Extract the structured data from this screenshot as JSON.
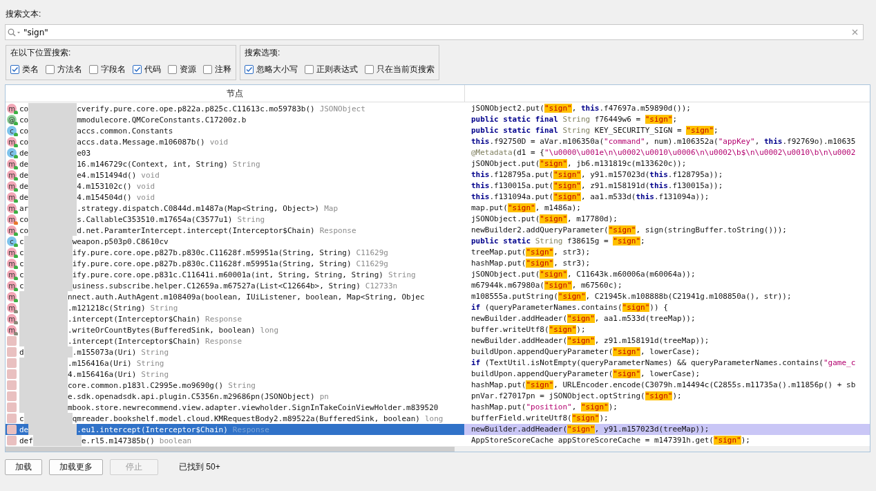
{
  "search": {
    "label": "搜索文本:",
    "value": "\"sign\""
  },
  "groups": [
    {
      "title": "在以下位置搜索:",
      "options": [
        {
          "label": "类名",
          "checked": true
        },
        {
          "label": "方法名",
          "checked": false
        },
        {
          "label": "字段名",
          "checked": false
        },
        {
          "label": "代码",
          "checked": true
        },
        {
          "label": "资源",
          "checked": false
        },
        {
          "label": "注释",
          "checked": false
        }
      ]
    },
    {
      "title": "搜索选项:",
      "options": [
        {
          "label": "忽略大小写",
          "checked": true
        },
        {
          "label": "正则表达式",
          "checked": false
        },
        {
          "label": "只在当前页搜索",
          "checked": false
        }
      ]
    }
  ],
  "table": {
    "columns": [
      "节点"
    ],
    "rows": [
      {
        "icon": "m",
        "color": "#3cb043",
        "prefix": "co",
        "name": "cverify.pure.core.ope.p822a.p825c.C11613c.mo59783b()",
        "type": "JSONObject",
        "selected": false,
        "code": [
          {
            "kind": "p",
            "text": "jSONObject2.put("
          },
          {
            "kind": "m",
            "text": "\"sign\""
          },
          {
            "kind": "p",
            "text": ", "
          },
          {
            "kind": "k",
            "text": "this"
          },
          {
            "kind": "p",
            "text": ".f47697a.m59890d());"
          }
        ]
      },
      {
        "icon": "@",
        "color": "#3cb043",
        "prefix": "co",
        "name": "mmodulecore.QMCoreConstants.C17200z.b",
        "selected": false,
        "code": [
          {
            "kind": "k",
            "text": "public static final "
          },
          {
            "kind": "t",
            "text": "String"
          },
          {
            "kind": "p",
            "text": " f76449w6 = "
          },
          {
            "kind": "m",
            "text": "\"sign\""
          },
          {
            "kind": "p",
            "text": ";"
          }
        ]
      },
      {
        "icon": "c",
        "color": "#3cb043",
        "prefix": "co",
        "name": "accs.common.Constants",
        "selected": false,
        "code": [
          {
            "kind": "k",
            "text": "public static final "
          },
          {
            "kind": "t",
            "text": "String"
          },
          {
            "kind": "p",
            "text": " KEY_SECURITY_SIGN = "
          },
          {
            "kind": "m",
            "text": "\"sign\""
          },
          {
            "kind": "p",
            "text": ";"
          }
        ]
      },
      {
        "icon": "m",
        "color": "#3cb043",
        "prefix": "co",
        "name": "accs.data.Message.m106087b()",
        "type": "void",
        "selected": false,
        "code": [
          {
            "kind": "k",
            "text": "this"
          },
          {
            "kind": "p",
            "text": ".f92750D = aVar.m106350a("
          },
          {
            "kind": "s",
            "text": "\"command\""
          },
          {
            "kind": "p",
            "text": ", num).m106352a("
          },
          {
            "kind": "s",
            "text": "\"appKey\""
          },
          {
            "kind": "p",
            "text": ", "
          },
          {
            "kind": "k",
            "text": "this"
          },
          {
            "kind": "p",
            "text": ".f92769o).m10635"
          }
        ]
      },
      {
        "icon": "c",
        "color": "#3cb043",
        "prefix": "de",
        "name": "e03",
        "selected": false,
        "code": [
          {
            "kind": "t",
            "text": "@Metadata"
          },
          {
            "kind": "p",
            "text": "(d1 = {"
          },
          {
            "kind": "s",
            "text": "\"\\u0000\\u001e\\n\\u0002\\u0010\\u0006\\n\\u0002\\b$\\n\\u0002\\u0010\\b\\n\\u0002"
          }
        ]
      },
      {
        "icon": "m",
        "color": "#3cb043",
        "prefix": "de",
        "name": "16.m146729c(Context, int, String)",
        "type": "String",
        "selected": false,
        "code": [
          {
            "kind": "p",
            "text": "jSONObject.put("
          },
          {
            "kind": "m",
            "text": "\"sign\""
          },
          {
            "kind": "p",
            "text": ", jb6.m131819c(m133620c));"
          }
        ]
      },
      {
        "icon": "m",
        "color": "#3cb043",
        "prefix": "de",
        "name": "e4.m151494d()",
        "type": "void",
        "selected": false,
        "code": [
          {
            "kind": "k",
            "text": "this"
          },
          {
            "kind": "p",
            "text": ".f128795a.put("
          },
          {
            "kind": "m",
            "text": "\"sign\""
          },
          {
            "kind": "p",
            "text": ", y91.m157023d("
          },
          {
            "kind": "k",
            "text": "this"
          },
          {
            "kind": "p",
            "text": ".f128795a));"
          }
        ]
      },
      {
        "icon": "m",
        "color": "#3cb043",
        "prefix": "de",
        "name": "4.m153102c()",
        "type": "void",
        "selected": false,
        "code": [
          {
            "kind": "k",
            "text": "this"
          },
          {
            "kind": "p",
            "text": ".f130015a.put("
          },
          {
            "kind": "m",
            "text": "\"sign\""
          },
          {
            "kind": "p",
            "text": ", z91.m158191d("
          },
          {
            "kind": "k",
            "text": "this"
          },
          {
            "kind": "p",
            "text": ".f130015a));"
          }
        ]
      },
      {
        "icon": "m",
        "color": "#3cb043",
        "prefix": "de",
        "name": "4.m154504d()",
        "type": "void",
        "selected": false,
        "code": [
          {
            "kind": "k",
            "text": "this"
          },
          {
            "kind": "p",
            "text": ".f131094a.put("
          },
          {
            "kind": "m",
            "text": "\"sign\""
          },
          {
            "kind": "p",
            "text": ", aa1.m533d("
          },
          {
            "kind": "k",
            "text": "this"
          },
          {
            "kind": "p",
            "text": ".f131094a));"
          }
        ]
      },
      {
        "icon": "m",
        "color": "#3cb043",
        "prefix": "ar",
        "name": ".strategy.dispatch.C0844d.m1487a(Map<String, Object>)",
        "type": "Map",
        "selected": false,
        "code": [
          {
            "kind": "p",
            "text": "map.put("
          },
          {
            "kind": "m",
            "text": "\"sign\""
          },
          {
            "kind": "p",
            "text": ", m1486a);"
          }
        ]
      },
      {
        "icon": "m",
        "color": "#e8762c",
        "prefix": "co",
        "name": "s.CallableC353510.m17654a(C3577u1)",
        "type": "String",
        "selected": false,
        "code": [
          {
            "kind": "p",
            "text": "jSONObject.put("
          },
          {
            "kind": "m",
            "text": "\"sign\""
          },
          {
            "kind": "p",
            "text": ", m17780d);"
          }
        ]
      },
      {
        "icon": "m",
        "color": "#3cb043",
        "prefix": "co",
        "name": "d.net.ParamterIntercept.intercept(Interceptor$Chain)",
        "type": "Response",
        "selected": false,
        "code": [
          {
            "kind": "p",
            "text": "newBuilder2.addQueryParameter("
          },
          {
            "kind": "m",
            "text": "\"sign\""
          },
          {
            "kind": "p",
            "text": ", sign(stringBuffer.toString()));"
          }
        ]
      },
      {
        "icon": "c",
        "color": "#3cb043",
        "prefix": "c",
        "name": "weapon.p503p0.C8610cv",
        "selected": false,
        "code": [
          {
            "kind": "k",
            "text": "public static "
          },
          {
            "kind": "t",
            "text": "String"
          },
          {
            "kind": "p",
            "text": " f38615g = "
          },
          {
            "kind": "m",
            "text": "\"sign\""
          },
          {
            "kind": "p",
            "text": ";"
          }
        ]
      },
      {
        "icon": "m",
        "color": "#3cb043",
        "prefix": "c",
        "name": "ify.pure.core.ope.p827b.p830c.C11628f.m59951a(String, String)",
        "type": "C11629g",
        "selected": false,
        "code": [
          {
            "kind": "p",
            "text": "treeMap.put("
          },
          {
            "kind": "m",
            "text": "\"sign\""
          },
          {
            "kind": "p",
            "text": ", str3);"
          }
        ]
      },
      {
        "icon": "m",
        "color": "#3cb043",
        "prefix": "c",
        "name": "ify.pure.core.ope.p827b.p830c.C11628f.m59951a(String, String)",
        "type": "C11629g",
        "selected": false,
        "code": [
          {
            "kind": "p",
            "text": "hashMap.put("
          },
          {
            "kind": "m",
            "text": "\"sign\""
          },
          {
            "kind": "p",
            "text": ", str3);"
          }
        ]
      },
      {
        "icon": "m",
        "color": "#3cb043",
        "prefix": "c",
        "name": "ify.pure.core.ope.p831c.C11641i.m60001a(int, String, String, String)",
        "type": "String",
        "selected": false,
        "code": [
          {
            "kind": "p",
            "text": "jSONObject.put("
          },
          {
            "kind": "m",
            "text": "\"sign\""
          },
          {
            "kind": "p",
            "text": ", C11643k.m60006a(m60064a));"
          }
        ]
      },
      {
        "icon": "m",
        "color": "#3cb043",
        "prefix": "c",
        "name": "usiness.subscribe.helper.C12659a.m67527a(List<C12664b>, String)",
        "type": "C12733n",
        "selected": false,
        "code": [
          {
            "kind": "p",
            "text": "m67944k.m67980a("
          },
          {
            "kind": "m",
            "text": "\"sign\""
          },
          {
            "kind": "p",
            "text": ", m67560c);"
          }
        ]
      },
      {
        "icon": "m",
        "color": "#3cb043",
        "name": "nnect.auth.AuthAgent.m108409a(boolean, IUiListener, boolean, Map<String, Objec",
        "selected": false,
        "code": [
          {
            "kind": "p",
            "text": "m108555a.putString("
          },
          {
            "kind": "m",
            "text": "\"sign\""
          },
          {
            "kind": "p",
            "text": ", C21945k.m108888b(C21941g.m108850a(), str));"
          }
        ]
      },
      {
        "icon": "m",
        "color": "#8a8a7a",
        "name": ".m121218c(String)",
        "type": "String",
        "selected": false,
        "code": [
          {
            "kind": "k",
            "text": "if"
          },
          {
            "kind": "p",
            "text": " (queryParameterNames.contains("
          },
          {
            "kind": "m",
            "text": "\"sign\""
          },
          {
            "kind": "p",
            "text": ")) {"
          }
        ]
      },
      {
        "icon": "m",
        "color": "#8a8a7a",
        "name": ".intercept(Interceptor$Chain)",
        "type": "Response",
        "selected": false,
        "code": [
          {
            "kind": "p",
            "text": "newBuilder.addHeader("
          },
          {
            "kind": "m",
            "text": "\"sign\""
          },
          {
            "kind": "p",
            "text": ", aa1.m533d(treeMap));"
          }
        ]
      },
      {
        "icon": "m",
        "color": "#8a8a7a",
        "name": ".writeOrCountBytes(BufferedSink, boolean)",
        "type": "long",
        "selected": false,
        "code": [
          {
            "kind": "p",
            "text": "buffer.writeUtf8("
          },
          {
            "kind": "m",
            "text": "\"sign\""
          },
          {
            "kind": "p",
            "text": ");"
          }
        ]
      },
      {
        "name": ".intercept(Interceptor$Chain)",
        "type": "Response",
        "selected": false,
        "code": [
          {
            "kind": "p",
            "text": "newBuilder.addHeader("
          },
          {
            "kind": "m",
            "text": "\"sign\""
          },
          {
            "kind": "p",
            "text": ", z91.m158191d(treeMap));"
          }
        ]
      },
      {
        "prefix": "d",
        "name": ".m155073a(Uri)",
        "type": "String",
        "selected": false,
        "code": [
          {
            "kind": "p",
            "text": "buildUpon.appendQueryParameter("
          },
          {
            "kind": "m",
            "text": "\"sign\""
          },
          {
            "kind": "p",
            "text": ", lowerCase);"
          }
        ]
      },
      {
        "name": ".m156416a(Uri)",
        "type": "String",
        "selected": false,
        "code": [
          {
            "kind": "k",
            "text": "if"
          },
          {
            "kind": "p",
            "text": " (TextUtil.isNotEmpty(queryParameterNames) && queryParameterNames.contains("
          },
          {
            "kind": "s",
            "text": "\"game_c"
          }
        ]
      },
      {
        "name": "4.m156416a(Uri)",
        "type": "String",
        "selected": false,
        "code": [
          {
            "kind": "p",
            "text": "buildUpon.appendQueryParameter("
          },
          {
            "kind": "m",
            "text": "\"sign\""
          },
          {
            "kind": "p",
            "text": ", lowerCase);"
          }
        ]
      },
      {
        "name": "core.common.p183l.C2995e.mo9690g()",
        "type": "String",
        "selected": false,
        "code": [
          {
            "kind": "p",
            "text": "hashMap.put("
          },
          {
            "kind": "m",
            "text": "\"sign\""
          },
          {
            "kind": "p",
            "text": ", URLEncoder.encode(C3079h.m14494c(C2855s.m11735a().m11856p() + sb"
          }
        ]
      },
      {
        "name": "e.sdk.openadsdk.api.plugin.C5356n.m29686pn(JSONObject)",
        "type": "pn",
        "selected": false,
        "code": [
          {
            "kind": "p",
            "text": "pnVar.f27017pn = jSONObject.optString("
          },
          {
            "kind": "m",
            "text": "\"sign\""
          },
          {
            "kind": "p",
            "text": ");"
          }
        ]
      },
      {
        "name": "mbook.store.newrecommend.view.adapter.viewholder.SignInTakeCoinViewHolder.m839520",
        "selected": false,
        "code": [
          {
            "kind": "p",
            "text": "hashMap.put("
          },
          {
            "kind": "s",
            "text": "\"position\""
          },
          {
            "kind": "p",
            "text": ", "
          },
          {
            "kind": "m",
            "text": "\"sign\""
          },
          {
            "kind": "p",
            "text": ");"
          }
        ]
      },
      {
        "prefix": "c",
        "name": "qmreader.bookshelf.model.cloud.KMRequestBody2.m89522a(BufferedSink, boolean)",
        "type": "long",
        "selected": false,
        "code": [
          {
            "kind": "p",
            "text": "bufferField.writeUtf8("
          },
          {
            "kind": "m",
            "text": "\"sign\""
          },
          {
            "kind": "p",
            "text": ");"
          }
        ]
      },
      {
        "prefix": "de",
        "name": ".eu1.intercept(Interceptor$Chain)",
        "type": "Response",
        "selected": true,
        "code": [
          {
            "kind": "p",
            "text": "newBuilder.addHeader("
          },
          {
            "kind": "m",
            "text": "\"sign\""
          },
          {
            "kind": "p",
            "text": ", y91.m157023d(treeMap));"
          }
        ]
      },
      {
        "prefix": "def",
        "name": "e.rl5.m147385b()",
        "type": "boolean",
        "selected": false,
        "code": [
          {
            "kind": "p",
            "text": "AppStoreScoreCache appStoreScoreCache = m147391h.get("
          },
          {
            "kind": "m",
            "text": "\"sign\""
          },
          {
            "kind": "p",
            "text": ");"
          }
        ]
      }
    ]
  },
  "buttons": [
    {
      "label": "加载",
      "disabled": false
    },
    {
      "label": "加载更多",
      "disabled": false
    },
    {
      "label": "停止",
      "disabled": true
    }
  ],
  "status": "已找到 50+"
}
